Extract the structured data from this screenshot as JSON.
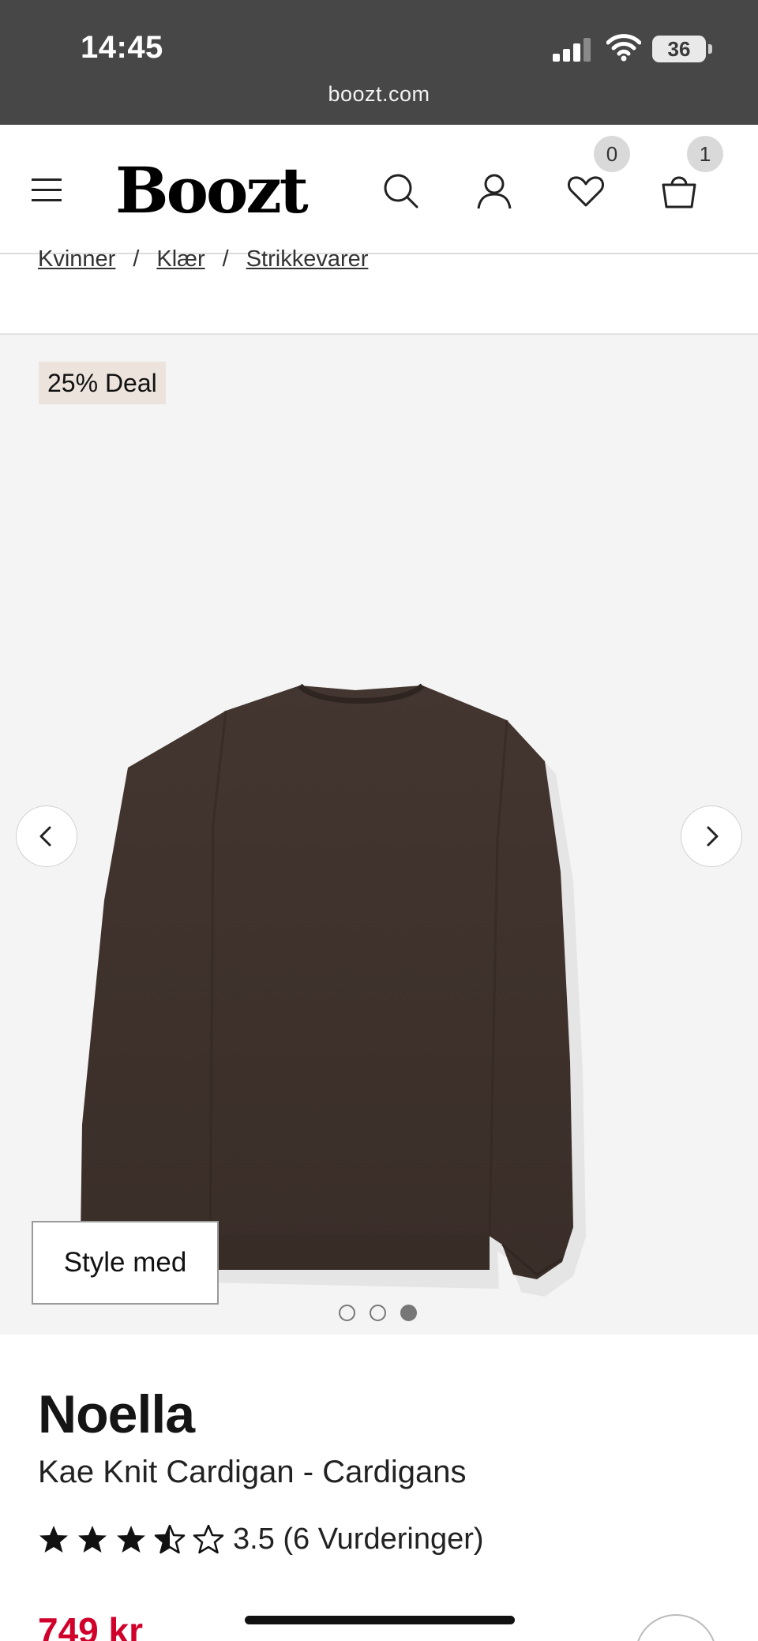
{
  "status_bar": {
    "time": "14:45",
    "battery": "36",
    "url": "boozt.com"
  },
  "header": {
    "logo": "Boozt",
    "wishlist_count": "0",
    "cart_count": "1",
    "icons": [
      "menu-icon",
      "search-icon",
      "user-icon",
      "heart-icon",
      "shopping-bag-icon"
    ]
  },
  "breadcrumb": {
    "items": [
      "Kvinner",
      "Klær",
      "Strikkevarer"
    ],
    "separator": "/"
  },
  "gallery": {
    "deal_badge": "25% Deal",
    "style_button": "Style med",
    "total_images": 3,
    "active_image": 3
  },
  "product": {
    "brand": "Noella",
    "name": "Kae Knit Cardigan - Cardigans",
    "rating_value": 3.5,
    "rating_text": "3.5 (6 Vurderinger)",
    "price": "749 kr"
  },
  "colors": {
    "status_bar": "#474747",
    "deal_badge": "#ece4dc",
    "price": "#d1002b",
    "sweater": "#3f322d"
  }
}
